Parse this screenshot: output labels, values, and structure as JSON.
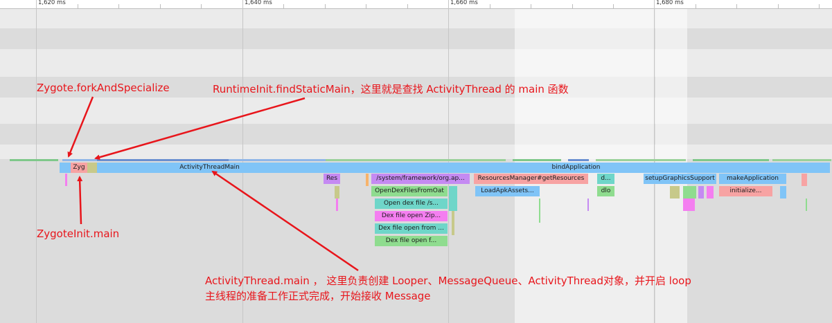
{
  "ruler": {
    "ticks": [
      "1,620 ms",
      "1,640 ms",
      "1,660 ms",
      "1,680 ms"
    ]
  },
  "slices": {
    "zygote": "Zyg",
    "activity_thread_main": "ActivityThreadMain",
    "bind_application": "bindApplication",
    "res": "Res",
    "system_framework": "/system/framework/org.ap...",
    "resources_manager": "ResourcesManager#getResources",
    "d_short": "d...",
    "setup_graphics": "setupGraphicsSupport",
    "make_application": "makeApplication",
    "open_dex_files": "OpenDexFilesFromOat",
    "load_apk_assets": "LoadApkAssets...",
    "dlo": "dlo",
    "initialize": "initialize...",
    "open_dex_file": "Open dex file /s...",
    "dex_open_zip": "Dex file open Zip...",
    "dex_open_from": "Dex file open from ...",
    "dex_open_f": "Dex file open f..."
  },
  "annotations": {
    "fork_and_specialize": "Zygote.forkAndSpecialize",
    "find_static_main": "RuntimeInit.findStaticMain，这里就是查找 ActivityThread 的 main 函数",
    "zygote_init_main": "ZygoteInit.main",
    "activity_thread_main_line1": "ActivityThread.main ， 这里负责创建 Looper、MessageQueue、ActivityThread对象，并开启 loop",
    "activity_thread_main_line2": "主线程的准备工作正式完成，开始接收 Message"
  },
  "colors": {
    "annotation_red": "#e8151b",
    "slice_blue": "#80c4f7",
    "slice_pink": "#f7a3a3",
    "slice_purple": "#c58af2",
    "slice_teal": "#6fd6c9",
    "slice_green": "#8fdc8f",
    "slice_magenta": "#f47ef0",
    "slice_olive": "#c7c98a"
  }
}
